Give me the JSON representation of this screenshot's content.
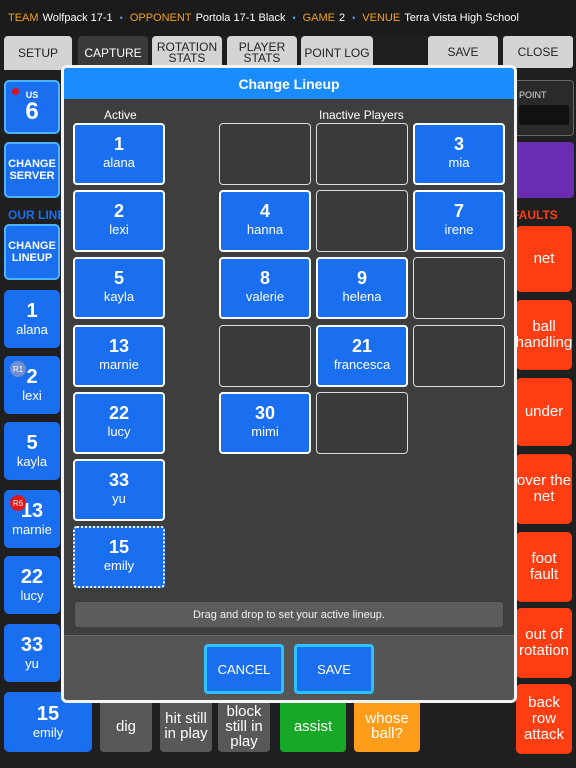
{
  "infobar": {
    "team_label": "TEAM",
    "team": "Wolfpack 17-1",
    "opponent_label": "OPPONENT",
    "opponent": "Portola 17-1 Black",
    "game_label": "GAME",
    "game": "2",
    "venue_label": "VENUE",
    "venue": "Terra Vista High School",
    "separator": "•"
  },
  "tabs": {
    "setup": "SETUP",
    "capture": "CAPTURE",
    "rotation_stats": "ROTATION STATS",
    "player_stats": "PLAYER STATS",
    "point_log": "POINT LOG",
    "save": "SAVE",
    "close": "CLOSE"
  },
  "background": {
    "us_label": "US",
    "us_score": "6",
    "change_server": "CHANGE SERVER",
    "our_lineup_label": "OUR LINEUP",
    "change_lineup": "CHANGE LINEUP",
    "point_label": "POINT",
    "faults_label": "FAULTS",
    "lineup": [
      {
        "number": "1",
        "name": "alana",
        "badge": ""
      },
      {
        "number": "2",
        "name": "lexi",
        "badge": "R1"
      },
      {
        "number": "5",
        "name": "kayla",
        "badge": ""
      },
      {
        "number": "13",
        "name": "marnie",
        "badge": "R6"
      },
      {
        "number": "22",
        "name": "lucy",
        "badge": ""
      },
      {
        "number": "33",
        "name": "yu",
        "badge": ""
      },
      {
        "number": "15",
        "name": "emily",
        "badge": ""
      }
    ],
    "faults": [
      "net",
      "ball handling",
      "under",
      "over the net",
      "foot fault",
      "out of rotation",
      "back row attack"
    ],
    "actions": [
      "dig",
      "hit still in play",
      "block still in play",
      "assist",
      "whose ball?"
    ],
    "colors": {
      "accent": "#1a6ef0",
      "fault": "#ff3d12",
      "assist": "#18a828",
      "whose_ball": "#ff9d1a",
      "purple": "#6a2cb0"
    }
  },
  "modal": {
    "title": "Change Lineup",
    "active_label": "Active",
    "inactive_label": "Inactive Players",
    "active": [
      {
        "number": "1",
        "name": "alana"
      },
      {
        "number": "2",
        "name": "lexi"
      },
      {
        "number": "5",
        "name": "kayla"
      },
      {
        "number": "13",
        "name": "marnie"
      },
      {
        "number": "22",
        "name": "lucy"
      },
      {
        "number": "33",
        "name": "yu"
      },
      {
        "number": "15",
        "name": "emily"
      }
    ],
    "inactive_rows": [
      [
        null,
        null,
        {
          "number": "3",
          "name": "mia"
        }
      ],
      [
        {
          "number": "4",
          "name": "hanna"
        },
        null,
        {
          "number": "7",
          "name": "irene"
        }
      ],
      [
        {
          "number": "8",
          "name": "valerie"
        },
        {
          "number": "9",
          "name": "helena"
        },
        null
      ],
      [
        null,
        {
          "number": "21",
          "name": "francesca"
        },
        null
      ],
      [
        {
          "number": "30",
          "name": "mimi"
        },
        null
      ]
    ],
    "hint": "Drag and drop to set your active lineup.",
    "cancel": "CANCEL",
    "save": "SAVE"
  }
}
